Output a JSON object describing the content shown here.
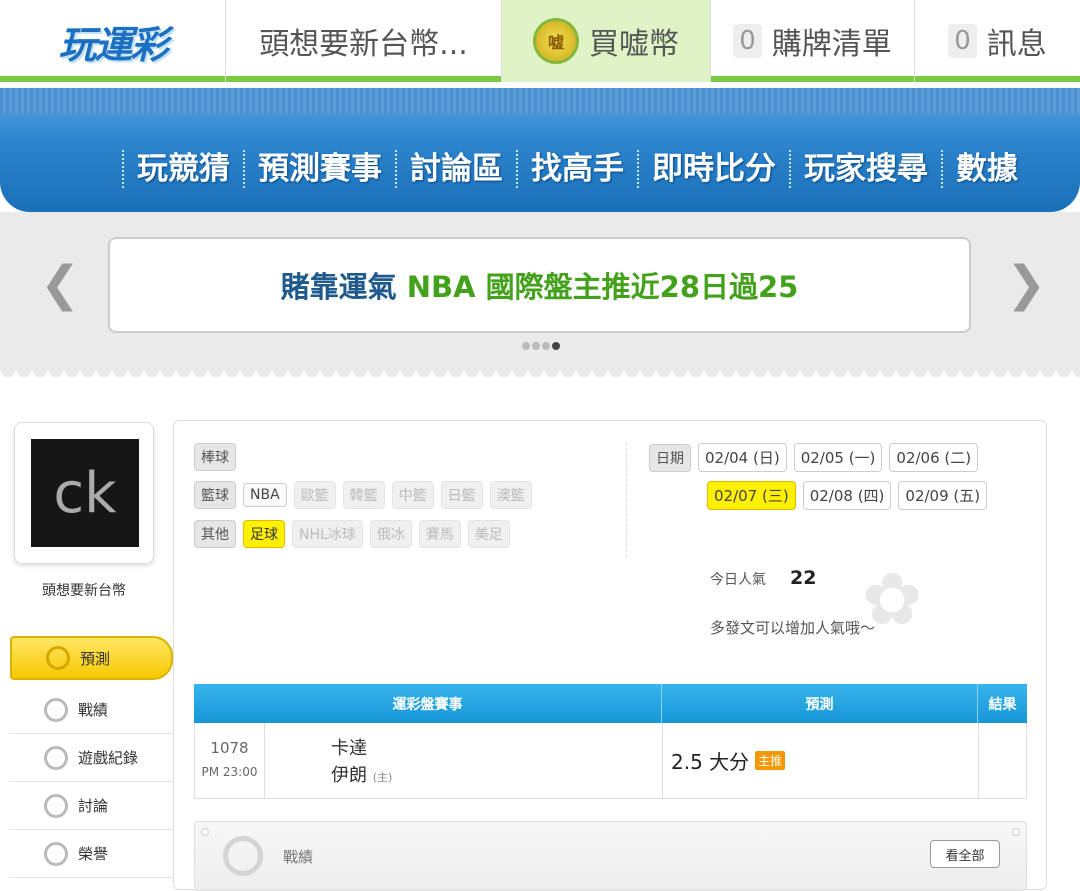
{
  "header": {
    "logo": "玩運彩",
    "user_tab": "頭想要新台幣...",
    "coin_icon_label": "嘘",
    "buy_coin": "買嘘幣",
    "cart_count": "0",
    "cart_label": "購牌清單",
    "msg_count": "0",
    "msg_label": "訊息"
  },
  "nav": [
    "玩競猜",
    "預測賽事",
    "討論區",
    "找高手",
    "即時比分",
    "玩家搜尋",
    "數據"
  ],
  "banner": {
    "text_part1": "賭靠運氣",
    "text_part2": "NBA 國際盤主推近28日過25",
    "color_part1": "#1e5a8c",
    "color_part2": "#43a11c"
  },
  "profile": {
    "avatar_text": "ck",
    "name": "頭想要新台幣"
  },
  "sidebar": [
    {
      "label": "預測",
      "icon": "target-icon",
      "active": true
    },
    {
      "label": "戰績",
      "icon": "record-icon"
    },
    {
      "label": "遊戲紀錄",
      "icon": "history-icon"
    },
    {
      "label": "討論",
      "icon": "discuss-icon"
    },
    {
      "label": "榮譽",
      "icon": "star-icon"
    }
  ],
  "categories": {
    "baseball": {
      "label": "棒球"
    },
    "basketball": {
      "label": "籃球",
      "items": [
        "NBA",
        "歐籃",
        "韓籃",
        "中籃",
        "日籃",
        "澳籃"
      ]
    },
    "other": {
      "label": "其他",
      "items": [
        "足球",
        "NHL冰球",
        "俄冰",
        "賽馬",
        "美足"
      ]
    }
  },
  "dates": {
    "label": "日期",
    "items": [
      "02/04 (日)",
      "02/05 (一)",
      "02/06 (二)",
      "02/07 (三)",
      "02/08 (四)",
      "02/09 (五)"
    ],
    "selected": "02/07 (三)"
  },
  "popularity": {
    "label": "今日人氣",
    "value": "22",
    "note": "多發文可以增加人氣哦～"
  },
  "table": {
    "headers": [
      "運彩盤賽事",
      "預測",
      "結果"
    ],
    "rows": [
      {
        "num": "1078",
        "time": "PM 23:00",
        "away": "卡達",
        "home": "伊朗",
        "home_tag": "(主)",
        "prediction": "2.5 大分",
        "pred_tag": "主推",
        "result": ""
      }
    ]
  },
  "record": {
    "label": "戰績",
    "button": "看全部"
  }
}
